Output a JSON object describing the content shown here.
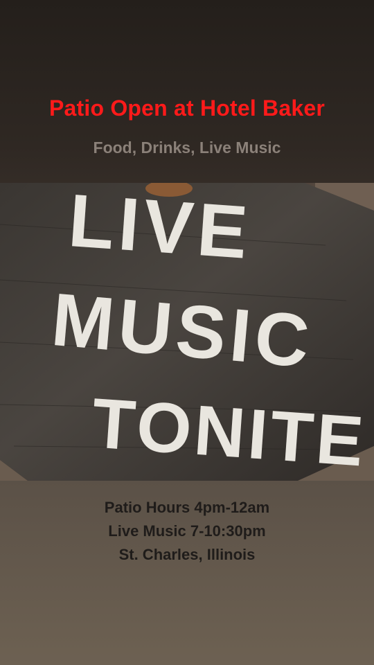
{
  "header": {
    "title": "Patio Open at Hotel Baker",
    "subtitle": "Food, Drinks, Live Music"
  },
  "photo": {
    "sign_lines": [
      "LIVE",
      "MUSIC",
      "TONITE"
    ]
  },
  "info": {
    "lines": [
      "Patio Hours 4pm-12am",
      "Live Music 7-10:30pm",
      "St. Charles, Illinois"
    ]
  },
  "colors": {
    "title": "#ff1a1a",
    "subtitle": "#8b8179",
    "info_text": "#1f1c1a"
  }
}
